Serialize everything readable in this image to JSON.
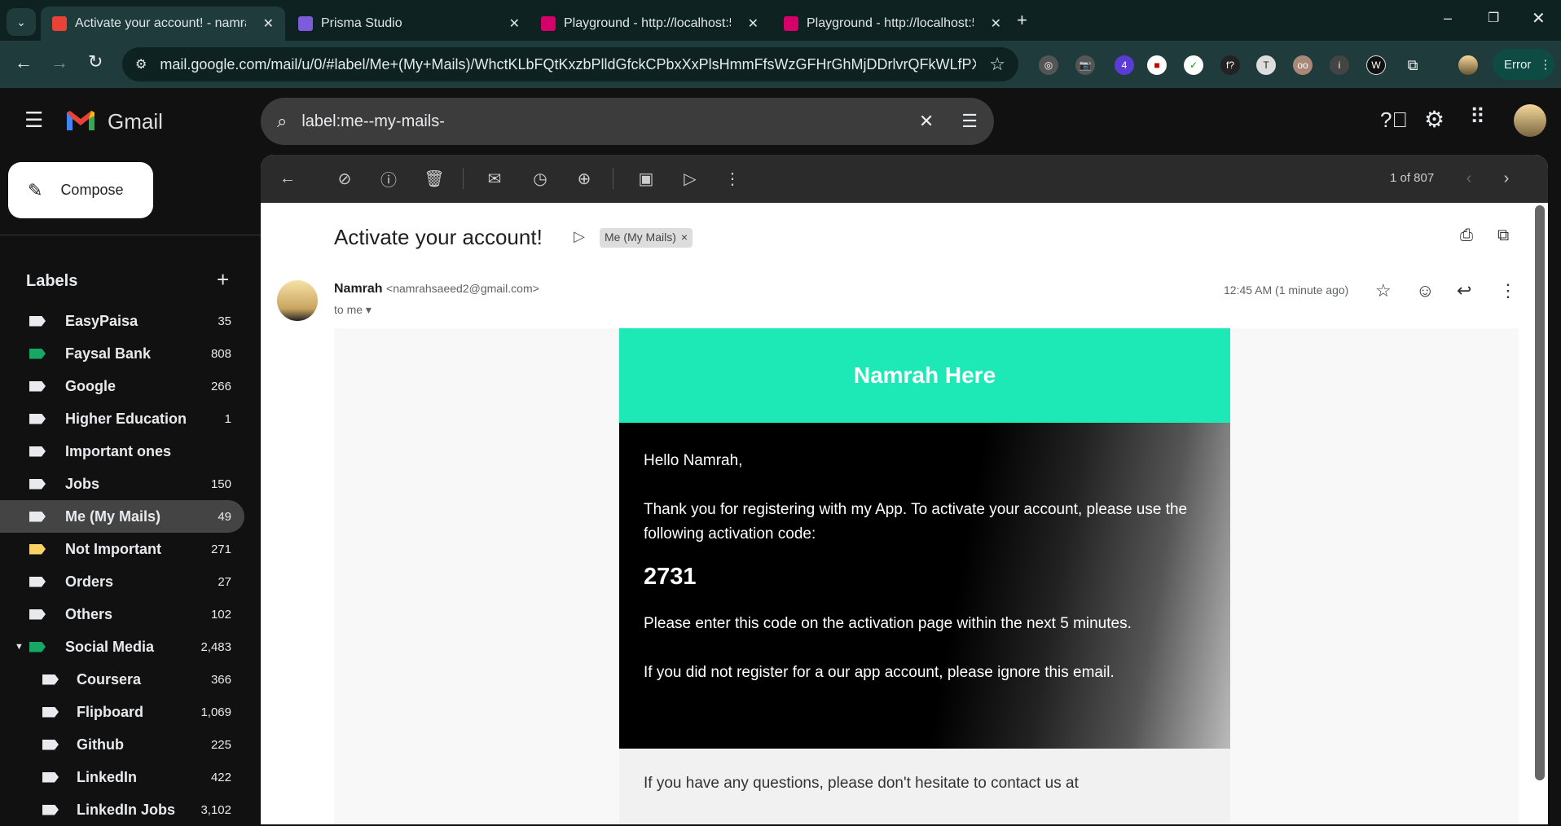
{
  "browser": {
    "tabs": [
      {
        "title": "Activate your account! - namrah",
        "active": true,
        "color": "#ea4335"
      },
      {
        "title": "Prisma Studio",
        "active": false,
        "color": "#7c5cdb"
      },
      {
        "title": "Playground - http://localhost:50",
        "active": false,
        "color": "#d6006b"
      },
      {
        "title": "Playground - http://localhost:50",
        "active": false,
        "color": "#d6006b"
      }
    ],
    "url": "mail.google.com/mail/u/0/#label/Me+(My+Mails)/WhctKLbFQtKxzbPlldGfckCPbxXxPlsHmmFfsWzGFHrGhMjDDrlvrQFkWLfPXjzp...",
    "extension_badge": "4",
    "profile_button": "Error"
  },
  "gmail": {
    "brand": "Gmail",
    "search_value": "label:me--my-mails-",
    "compose": "Compose",
    "labels_heading": "Labels",
    "labels": [
      {
        "name": "EasyPaisa",
        "count": "35",
        "color": "#e8eaed"
      },
      {
        "name": "Faysal Bank",
        "count": "808",
        "color": "#16a765"
      },
      {
        "name": "Google",
        "count": "266",
        "color": "#e8eaed"
      },
      {
        "name": "Higher Education",
        "count": "1",
        "color": "#e8eaed"
      },
      {
        "name": "Important ones",
        "count": "",
        "color": "#e8eaed"
      },
      {
        "name": "Jobs",
        "count": "150",
        "color": "#e8eaed"
      },
      {
        "name": "Me (My Mails)",
        "count": "49",
        "color": "#e8eaed",
        "active": true
      },
      {
        "name": "Not Important",
        "count": "271",
        "color": "#fad165"
      },
      {
        "name": "Orders",
        "count": "27",
        "color": "#e8eaed"
      },
      {
        "name": "Others",
        "count": "102",
        "color": "#e8eaed"
      },
      {
        "name": "Social Media",
        "count": "2,483",
        "color": "#16a765",
        "expanded": true
      },
      {
        "name": "Coursera",
        "count": "366",
        "color": "#e8eaed",
        "sub": true
      },
      {
        "name": "Flipboard",
        "count": "1,069",
        "color": "#e8eaed",
        "sub": true
      },
      {
        "name": "Github",
        "count": "225",
        "color": "#e8eaed",
        "sub": true
      },
      {
        "name": "LinkedIn",
        "count": "422",
        "color": "#e8eaed",
        "sub": true
      },
      {
        "name": "LinkedIn Jobs",
        "count": "3,102",
        "color": "#e8eaed",
        "sub": true
      }
    ],
    "pager": "1 of 807"
  },
  "email": {
    "subject": "Activate your account!",
    "label_chip": "Me (My Mails)",
    "sender_name": "Namrah",
    "sender_email": "<namrahsaeed2@gmail.com>",
    "to": "to me",
    "time": "12:45 AM (1 minute ago)",
    "body": {
      "banner": "Namrah Here",
      "banner_color": "#1de9b6",
      "greeting": "Hello Namrah,",
      "para1": "Thank you for registering with my App. To activate your account, please use the following activation code:",
      "code": "2731",
      "para2": "Please enter this code on the activation page within the next 5 minutes.",
      "para3": "If you did not register for a our app account, please ignore this email.",
      "footer": "If you have any questions, please don't hesitate to contact us at"
    }
  }
}
